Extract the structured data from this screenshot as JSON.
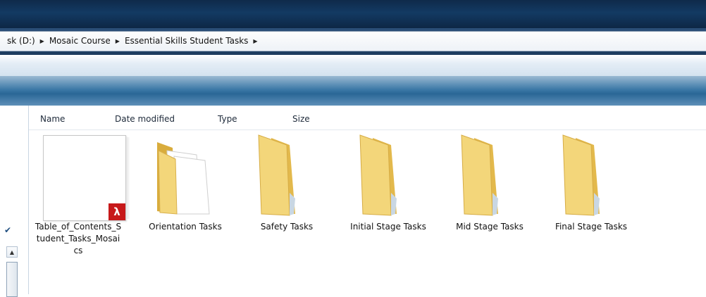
{
  "address": {
    "crumbs": [
      "sk (D:)",
      "Mosaic Course",
      "Essential Skills Student Tasks"
    ]
  },
  "columns": {
    "name": "Name",
    "date": "Date modified",
    "type": "Type",
    "size": "Size"
  },
  "items": [
    {
      "label": "Table_of_Contents_Student_Tasks_Mosaics",
      "icon": "pdf-file-icon"
    },
    {
      "label": "Orientation Tasks",
      "icon": "folder-with-documents-icon"
    },
    {
      "label": "Safety Tasks",
      "icon": "folder-icon"
    },
    {
      "label": "Initial Stage Tasks",
      "icon": "folder-icon"
    },
    {
      "label": "Mid Stage Tasks",
      "icon": "folder-icon"
    },
    {
      "label": "Final Stage Tasks",
      "icon": "folder-icon"
    }
  ],
  "colors": {
    "folder_front": "#f3d67a",
    "folder_back": "#e3b94c",
    "pdf_badge": "#c7191a",
    "title_dark": "#0f2a4a"
  }
}
